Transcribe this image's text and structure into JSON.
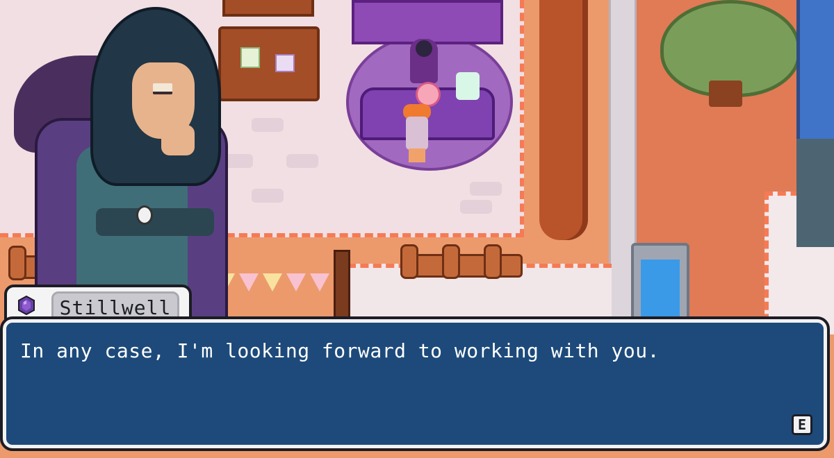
{
  "speaker": {
    "name": "Stillwell",
    "icon": "amethyst-gem-icon"
  },
  "dialogue": {
    "text": "In any case, I'm looking forward to working with you.",
    "advance_key": "E"
  },
  "colors": {
    "dialogue_bg": "#1d4a7a",
    "dialogue_border": "#f2f2f2",
    "nametag_bg": "#c9c9cf",
    "gem": "#6a3fa8"
  }
}
